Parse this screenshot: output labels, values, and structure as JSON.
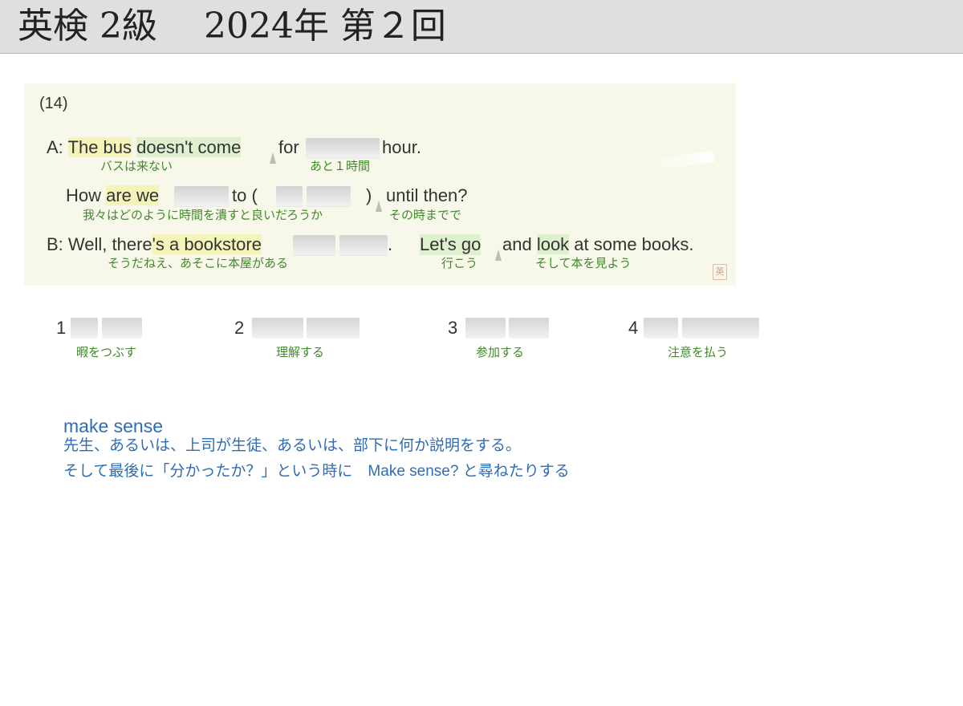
{
  "header": {
    "title": "英検 2級　 2024年 第２回"
  },
  "question": {
    "number": "(14)",
    "lineA": {
      "speaker": "A: ",
      "p1": "The bus",
      "p2": " ",
      "p3": "doesn't come",
      "p4": "for",
      "p5": "hour.",
      "gloss1": "バスは来ない",
      "gloss2": "あと１時間"
    },
    "lineA2": {
      "p1": "How ",
      "p2": "are we",
      "p3": "to (",
      "p4": ")",
      "p5": "until then?",
      "gloss1": "我々はどのように時間を潰すと良いだろうか",
      "gloss2": "その時までで"
    },
    "lineB": {
      "p1": "B: Well, there",
      "p2": "'s a bookstore",
      "p3": ".",
      "p4": "Let's go",
      "p5": "and ",
      "p6": "look",
      "p7": " at some books.",
      "gloss1": "そうだねえ、あそこに本屋がある",
      "gloss2": "行こう",
      "gloss3": "そして本を見よう"
    },
    "stamp": "英"
  },
  "options": [
    {
      "number": "1",
      "gloss": "暇をつぶす"
    },
    {
      "number": "2",
      "gloss": "理解する"
    },
    {
      "number": "3",
      "gloss": "参加する"
    },
    {
      "number": "4",
      "gloss": "注意を払う"
    }
  ],
  "note": {
    "title": "make sense",
    "line1": "先生、あるいは、上司が生徒、あるいは、部下に何か説明をする。",
    "line2": "そして最後に「分かったか？」という時に　Make sense? と尋ねたりする"
  },
  "colors": {
    "gloss": "#3f8a2a",
    "note": "#2e6db4",
    "card": "#f7f8e9"
  }
}
